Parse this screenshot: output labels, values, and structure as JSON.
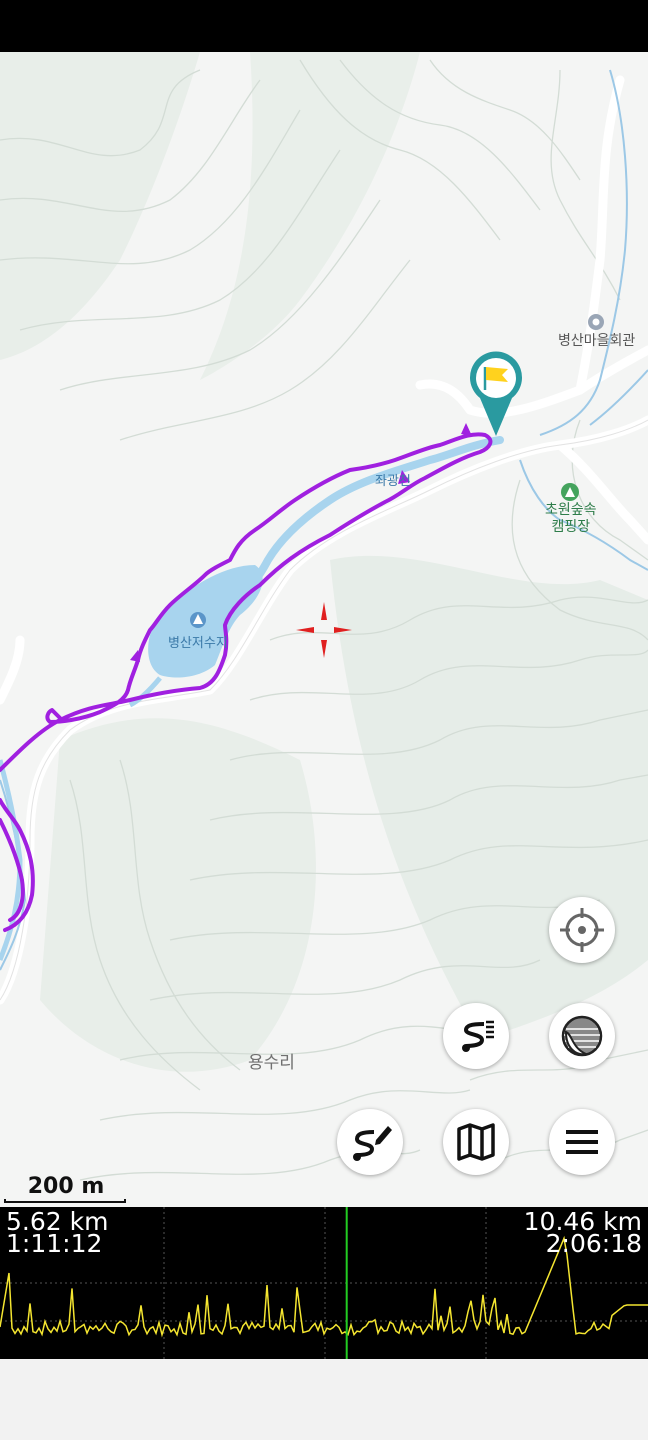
{
  "map": {
    "places": {
      "village_hall": "병산마을회관",
      "stream": "좌광천",
      "reservoir": "병산저수지",
      "campsite_line1": "초원숲속",
      "campsite_line2": "캠핑장",
      "district": "용수리"
    },
    "scale_label": "200 m",
    "colors": {
      "track": "#a020e0",
      "water": "#a8d4ee",
      "pin": "#2a9aa0",
      "flag": "#ffd21e",
      "crosshair": "#e02020"
    }
  },
  "buttons": {
    "locate": "crosshair-icon",
    "layers": "layers-icon",
    "route_list": "route-list-icon",
    "route_edit": "route-edit-icon",
    "maps": "map-icon",
    "menu": "menu-icon"
  },
  "profile": {
    "left_distance": "5.62 km",
    "left_time": "1:11:12",
    "right_distance": "10.46 km",
    "right_time": "2:06:18",
    "cursor_fraction": 0.535,
    "line_color": "#f4e530",
    "cursor_color": "#22cc22"
  }
}
